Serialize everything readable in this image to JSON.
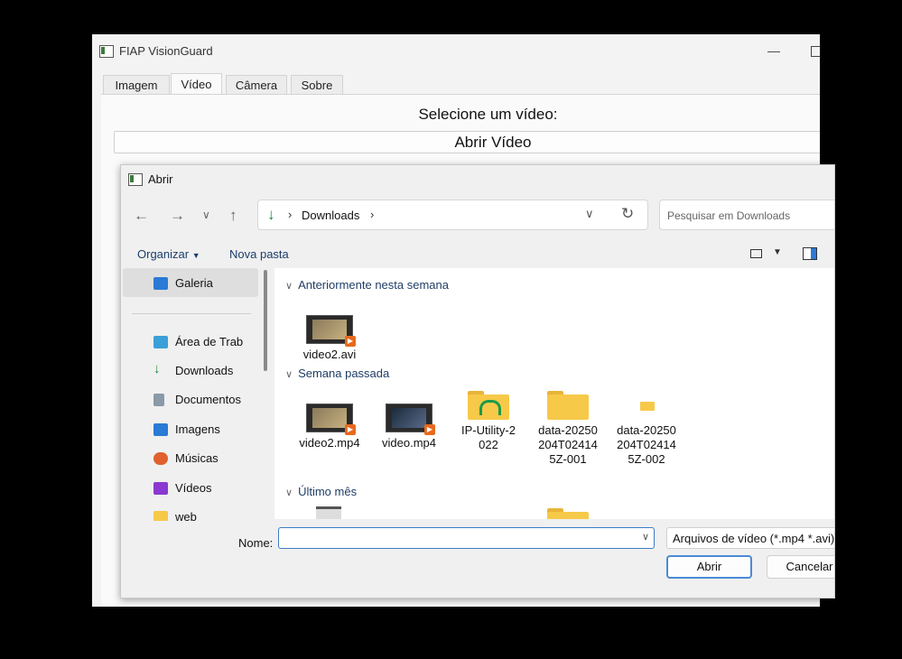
{
  "app": {
    "title": "FIAP VisionGuard",
    "tabs": [
      "Imagem",
      "Vídeo",
      "Câmera",
      "Sobre"
    ],
    "active_tab": "Vídeo",
    "prompt": "Selecione um vídeo:",
    "open_video_label": "Abrir Vídeo"
  },
  "dialog": {
    "title": "Abrir",
    "breadcrumb": "Downloads",
    "search_placeholder": "Pesquisar em Downloads",
    "organize_label": "Organizar",
    "new_folder_label": "Nova pasta",
    "sidebar": {
      "gallery": "Galeria",
      "items": [
        {
          "label": "Área de Trab",
          "icon": "desktop-icon",
          "color": "#3aa0d8"
        },
        {
          "label": "Downloads",
          "icon": "download-icon",
          "color": "#1a8a3a"
        },
        {
          "label": "Documentos",
          "icon": "document-icon",
          "color": "#8a9aa8"
        },
        {
          "label": "Imagens",
          "icon": "image-icon",
          "color": "#2a7ad6"
        },
        {
          "label": "Músicas",
          "icon": "music-icon",
          "color": "#e06030"
        },
        {
          "label": "Vídeos",
          "icon": "video-icon",
          "color": "#8a3ad0"
        },
        {
          "label": "web",
          "icon": "folder-icon",
          "color": "#f7c948"
        }
      ]
    },
    "groups": [
      {
        "header": "Anteriormente nesta semana",
        "files": [
          {
            "name": "video2.avi",
            "kind": "video"
          }
        ]
      },
      {
        "header": "Semana passada",
        "files": [
          {
            "name": "video2.mp4",
            "kind": "video"
          },
          {
            "name": "video.mp4",
            "kind": "video"
          },
          {
            "name": "IP-Utility-2022",
            "lines": [
              "IP-Utility-2",
              "022"
            ],
            "kind": "folder-special"
          },
          {
            "name": "data-20250204T024145Z-001",
            "lines": [
              "data-20250",
              "204T02414",
              "5Z-001"
            ],
            "kind": "folder"
          },
          {
            "name": "data-20250204T024145Z-002",
            "lines": [
              "data-20250",
              "204T02414",
              "5Z-002"
            ],
            "kind": "folder-small"
          }
        ]
      },
      {
        "header": "Último mês",
        "files": []
      }
    ],
    "name_label": "Nome:",
    "name_value": "",
    "filter_label": "Arquivos de vídeo (*.mp4 *.avi)",
    "open_button": "Abrir",
    "cancel_button": "Cancelar"
  }
}
